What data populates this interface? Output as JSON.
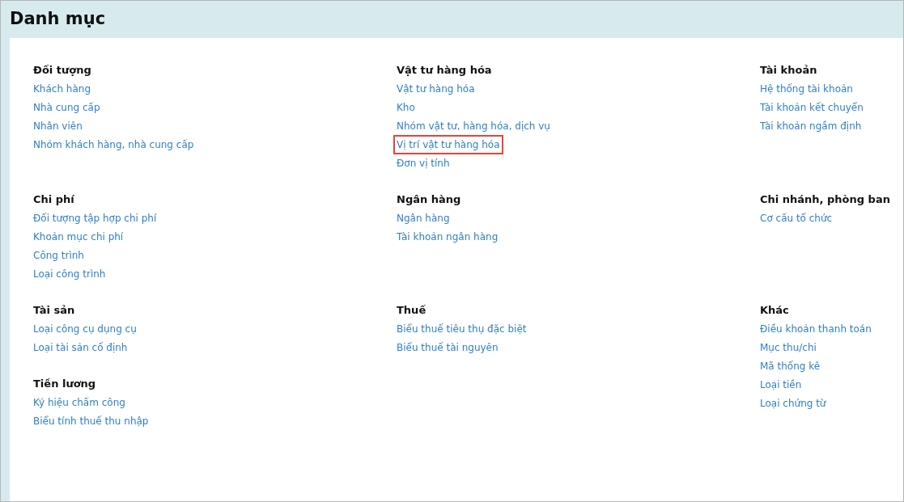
{
  "title": "Danh mục",
  "rows": [
    {
      "cells": [
        [
          {
            "heading": "Đối tượng",
            "items": [
              {
                "label": "Khách hàng",
                "highlighted": false
              },
              {
                "label": "Nhà cung cấp",
                "highlighted": false
              },
              {
                "label": "Nhân viên",
                "highlighted": false
              },
              {
                "label": "Nhóm khách hàng, nhà cung cấp",
                "highlighted": false
              }
            ]
          }
        ],
        [
          {
            "heading": "Vật tư hàng hóa",
            "items": [
              {
                "label": "Vật tư hàng hóa",
                "highlighted": false
              },
              {
                "label": "Kho",
                "highlighted": false
              },
              {
                "label": "Nhóm vật tư, hàng hóa, dịch vụ",
                "highlighted": false
              },
              {
                "label": "Vị trí vật tư hàng hóa",
                "highlighted": true
              },
              {
                "label": "Đơn vị tính",
                "highlighted": false
              }
            ]
          }
        ],
        [
          {
            "heading": "Tài khoản",
            "items": [
              {
                "label": "Hệ thống tài khoản",
                "highlighted": false
              },
              {
                "label": "Tài khoản kết chuyển",
                "highlighted": false
              },
              {
                "label": "Tài khoản ngầm định",
                "highlighted": false
              }
            ]
          }
        ]
      ]
    },
    {
      "cells": [
        [
          {
            "heading": "Chi phí",
            "items": [
              {
                "label": "Đối tượng tập hợp chi phí",
                "highlighted": false
              },
              {
                "label": "Khoản mục chi phí",
                "highlighted": false
              },
              {
                "label": "Công trình",
                "highlighted": false
              },
              {
                "label": "Loại công trình",
                "highlighted": false
              }
            ]
          }
        ],
        [
          {
            "heading": "Ngân hàng",
            "items": [
              {
                "label": "Ngân hàng",
                "highlighted": false
              },
              {
                "label": "Tài khoản ngân hàng",
                "highlighted": false
              }
            ]
          }
        ],
        [
          {
            "heading": "Chi nhánh, phòng ban",
            "items": [
              {
                "label": "Cơ cấu tổ chức",
                "highlighted": false
              }
            ]
          }
        ]
      ]
    },
    {
      "cells": [
        [
          {
            "heading": "Tài sản",
            "items": [
              {
                "label": "Loại công cụ dụng cụ",
                "highlighted": false
              },
              {
                "label": "Loại tài sản cố định",
                "highlighted": false
              }
            ]
          },
          {
            "heading": "Tiền lương",
            "items": [
              {
                "label": "Ký hiệu chấm công",
                "highlighted": false
              },
              {
                "label": "Biểu tính thuế thu nhập",
                "highlighted": false
              }
            ]
          }
        ],
        [
          {
            "heading": "Thuế",
            "items": [
              {
                "label": "Biểu thuế tiêu thụ đặc biệt",
                "highlighted": false
              },
              {
                "label": "Biểu thuế tài nguyên",
                "highlighted": false
              }
            ]
          }
        ],
        [
          {
            "heading": "Khác",
            "items": [
              {
                "label": "Điều khoản thanh toán",
                "highlighted": false
              },
              {
                "label": "Mục thu/chi",
                "highlighted": false
              },
              {
                "label": "Mã thống kê",
                "highlighted": false
              },
              {
                "label": "Loại tiền",
                "highlighted": false
              },
              {
                "label": "Loại chứng từ",
                "highlighted": false
              }
            ]
          }
        ]
      ]
    }
  ]
}
